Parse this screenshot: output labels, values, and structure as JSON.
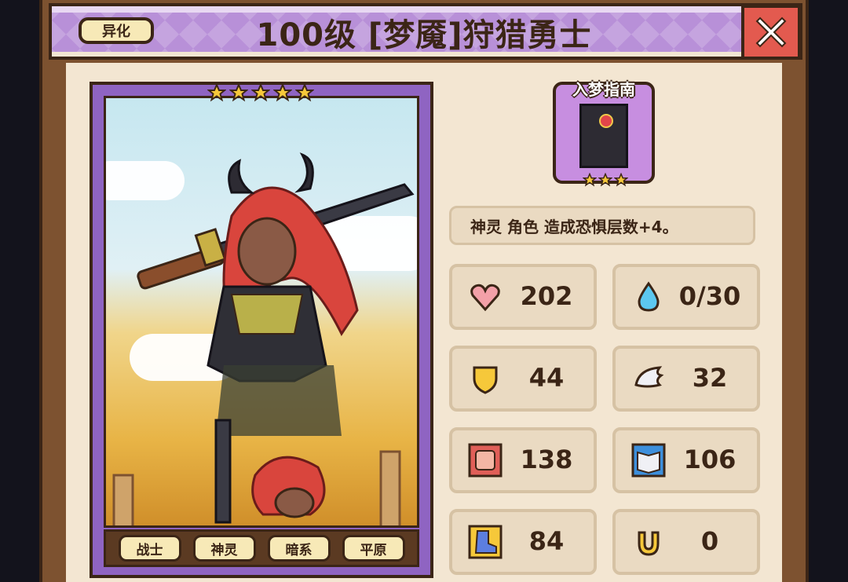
{
  "header": {
    "title": "100级 [梦魇]狩猎勇士",
    "badge_label": "异化"
  },
  "card": {
    "star_count": 5,
    "tags": [
      "战士",
      "神灵",
      "暗系",
      "平原"
    ]
  },
  "relic": {
    "name": "入梦指南",
    "star_count": 3
  },
  "description": "神灵 角色 造成恐惧层数+4。",
  "stats": [
    {
      "icon": "heart-icon",
      "value": "202"
    },
    {
      "icon": "water-drop-icon",
      "value": "0/30"
    },
    {
      "icon": "shield-icon",
      "value": "44"
    },
    {
      "icon": "wing-icon",
      "value": "32"
    },
    {
      "icon": "fist-icon",
      "value": "138"
    },
    {
      "icon": "spellbook-icon",
      "value": "106"
    },
    {
      "icon": "boot-icon",
      "value": "84"
    },
    {
      "icon": "horseshoe-icon",
      "value": "0"
    }
  ],
  "colors": {
    "frame": "#7d5230",
    "header": "#b890d8",
    "panel": "#f3e6d2",
    "card_border": "#8f64c2",
    "close": "#e35a4f",
    "text_dark": "#3b2516"
  }
}
